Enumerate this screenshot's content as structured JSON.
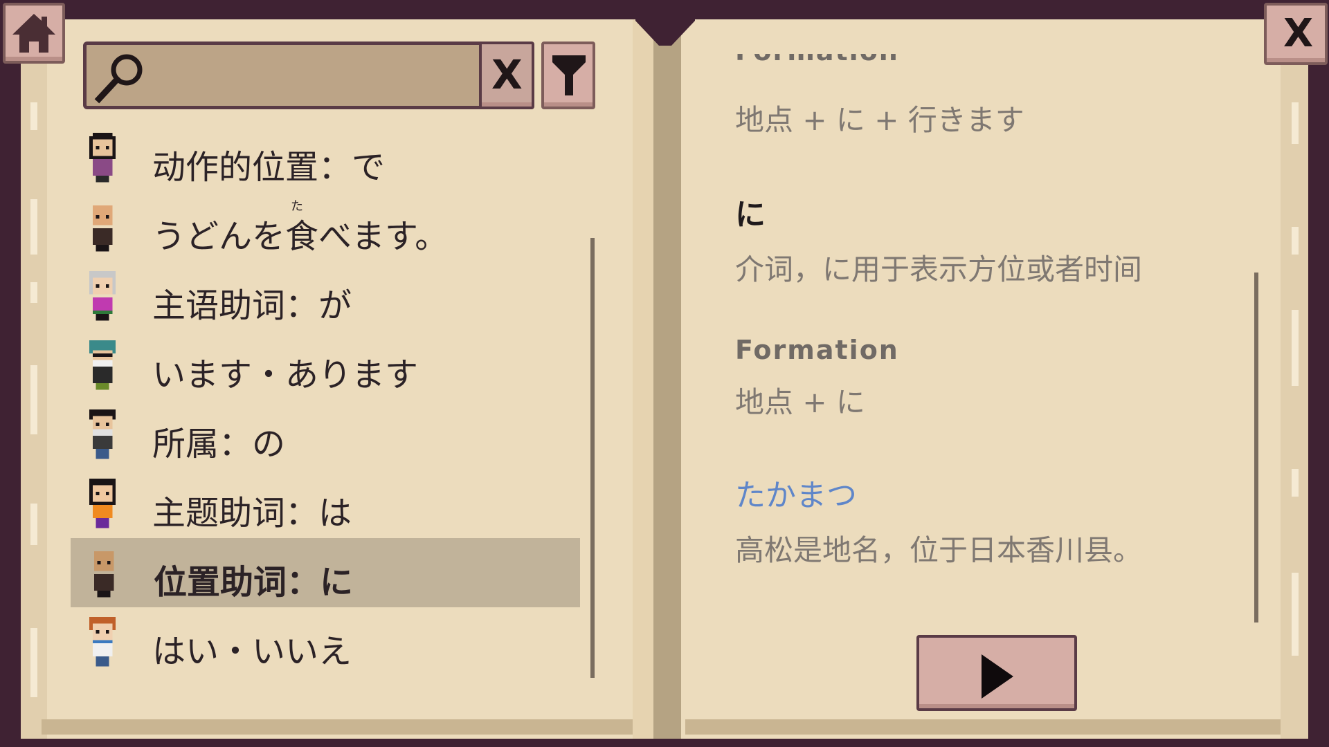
{
  "top_controls": {
    "home_icon": "home-icon",
    "close_label": "X"
  },
  "search": {
    "value": "",
    "placeholder": "",
    "clear_label": "X",
    "search_icon": "magnifier-icon",
    "filter_icon": "filter-icon"
  },
  "list": {
    "items": [
      {
        "label": "动作的位置：で",
        "avatar": "woman-black-hair"
      },
      {
        "label": "うどんを食べます。",
        "ruby": "た",
        "avatar": "bald-man"
      },
      {
        "label": "主语助词：が",
        "avatar": "grandma"
      },
      {
        "label": "います・あります",
        "avatar": "teal-hair-glasses"
      },
      {
        "label": "所属：の",
        "avatar": "bearded-man"
      },
      {
        "label": "主题助词：は",
        "avatar": "girl-orange"
      },
      {
        "label": "位置助词：に",
        "avatar": "bald-man-2"
      },
      {
        "label": "はい・いいえ",
        "avatar": "boy-ginger"
      }
    ],
    "selected_index": 6
  },
  "detail": {
    "clipped_heading": "Formation",
    "formation_1": "地点 + に + 行きます",
    "title": "に",
    "description": "介词，に用于表示方位或者时间",
    "formation_label": "Formation",
    "formation_2": "地点 + に",
    "example_word": "たかまつ",
    "example_desc": "高松是地名，位于日本香川县。",
    "next_icon": "play-arrow-icon"
  },
  "colors": {
    "frame": "#3f2233",
    "page": "#ecdcbd",
    "selected_row": "#c1b39a",
    "button": "#d6aea6",
    "link": "#5f86c9"
  }
}
